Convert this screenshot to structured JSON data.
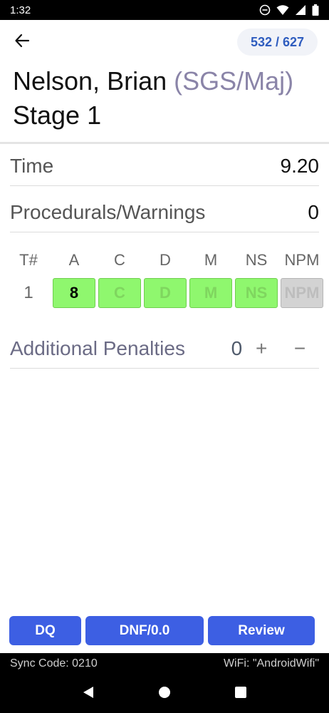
{
  "status_bar": {
    "time": "1:32",
    "icons": [
      "do-not-disturb-icon",
      "wifi-icon",
      "signal-icon",
      "battery-icon"
    ]
  },
  "header": {
    "counter": "532 / 627",
    "shooter_name": "Nelson, Brian",
    "division": "(SGS/Maj)",
    "stage": "Stage 1"
  },
  "fields": {
    "time_label": "Time",
    "time_value": "9.20",
    "procedurals_label": "Procedurals/Warnings",
    "procedurals_value": "0"
  },
  "hits": {
    "columns": [
      "T#",
      "A",
      "C",
      "D",
      "M",
      "NS",
      "NPM"
    ],
    "rows": [
      {
        "target": "1",
        "A": "8",
        "C": "C",
        "D": "D",
        "M": "M",
        "NS": "NS",
        "NPM": "NPM"
      }
    ]
  },
  "penalties": {
    "label": "Additional Penalties",
    "value": "0",
    "plus": "+",
    "minus": "−"
  },
  "buttons": {
    "dq": "DQ",
    "dnf": "DNF/0.0",
    "review": "Review"
  },
  "footer": {
    "sync_code": "Sync Code: 0210",
    "wifi": "WiFi: \"AndroidWifi\""
  },
  "colors": {
    "accent_blue": "#3d5fe3",
    "counter_text": "#2f5dbf",
    "score_green": "#8ff76e",
    "score_disabled": "#d3d3d3",
    "division_text": "#8a84a8"
  }
}
